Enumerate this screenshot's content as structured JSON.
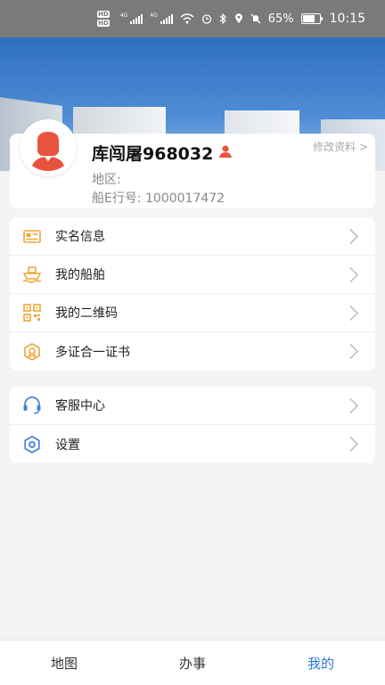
{
  "status_bar": {
    "hd1": "HD",
    "hd2": "HD",
    "net1": "4G",
    "net2": "4G",
    "battery_percent": "65%",
    "battery_level": 0.65,
    "time": "10:15"
  },
  "profile": {
    "name": "库闯屠968032",
    "edit_label": "修改资料 >",
    "region_label": "地区:",
    "ship_id_label": "船E行号: 1000017472"
  },
  "menu_group1": [
    {
      "label": "实名信息",
      "icon": "id-card-icon"
    },
    {
      "label": "我的船舶",
      "icon": "ship-icon"
    },
    {
      "label": "我的二维码",
      "icon": "qrcode-icon"
    },
    {
      "label": "多证合一证书",
      "icon": "certificate-icon"
    }
  ],
  "menu_group2": [
    {
      "label": "客服中心",
      "icon": "headset-icon"
    },
    {
      "label": "设置",
      "icon": "gear-icon"
    }
  ],
  "tabs": [
    {
      "label": "地图"
    },
    {
      "label": "办事"
    },
    {
      "label": "我的"
    }
  ],
  "colors": {
    "accent": "#2c77d9",
    "icon_orange": "#f0a43a",
    "icon_blue": "#3b82e0",
    "avatar": "#e8533f"
  }
}
